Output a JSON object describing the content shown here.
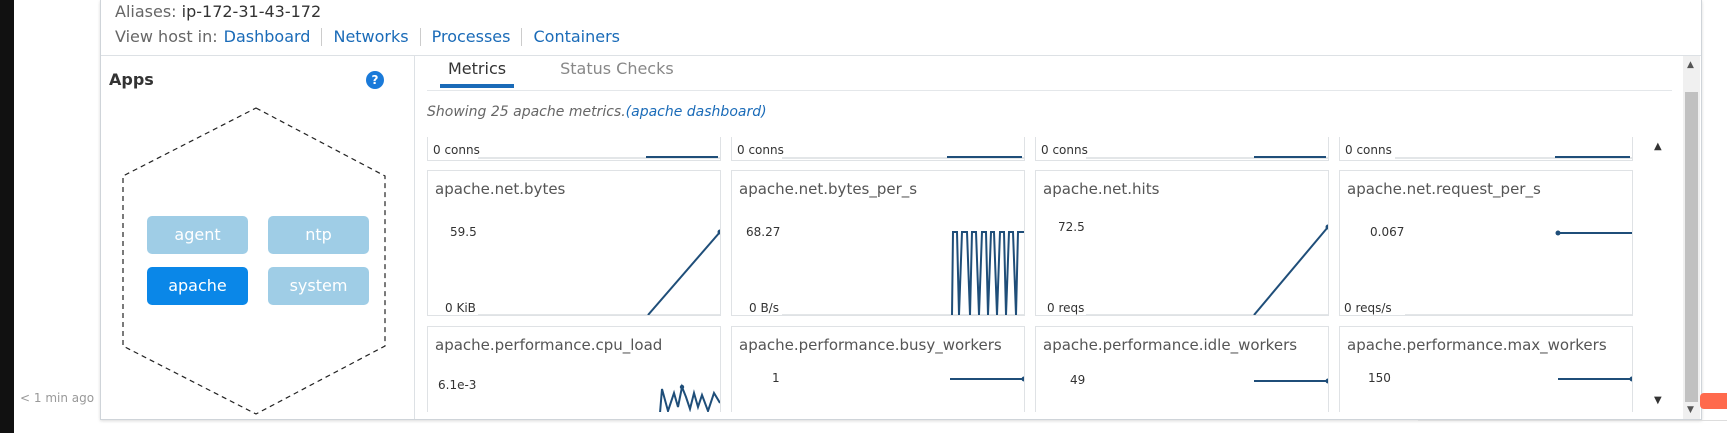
{
  "timestamp": "< 1 min ago",
  "host": {
    "aliases_label": "Aliases:",
    "aliases_value": "ip-172-31-43-172",
    "view_label": "View host in:",
    "links": [
      "Dashboard",
      "Networks",
      "Processes",
      "Containers"
    ]
  },
  "apps": {
    "title": "Apps",
    "help_icon": "question-circle-icon",
    "items": [
      {
        "label": "agent",
        "active": false
      },
      {
        "label": "ntp",
        "active": false
      },
      {
        "label": "apache",
        "active": true
      },
      {
        "label": "system",
        "active": false
      }
    ]
  },
  "tabs": [
    "Metrics",
    "Status Checks"
  ],
  "active_tab": "Metrics",
  "showing": {
    "text": "Showing 25 apache metrics.",
    "link": "(apache dashboard)"
  },
  "top_row": [
    "0 conns",
    "0 conns",
    "0 conns",
    "0 conns"
  ],
  "metrics": [
    {
      "name": "apache.net.bytes",
      "max": "59.5",
      "min": "0 KiB"
    },
    {
      "name": "apache.net.bytes_per_s",
      "max": "68.27",
      "min": "0 B/s"
    },
    {
      "name": "apache.net.hits",
      "max": "72.5",
      "min": "0 reqs"
    },
    {
      "name": "apache.net.request_per_s",
      "max": "0.067",
      "min": "0 reqs/s"
    },
    {
      "name": "apache.performance.cpu_load",
      "max": "6.1e-3",
      "min": ""
    },
    {
      "name": "apache.performance.busy_workers",
      "max": "1",
      "min": ""
    },
    {
      "name": "apache.performance.idle_workers",
      "max": "49",
      "min": ""
    },
    {
      "name": "apache.performance.max_workers",
      "max": "150",
      "min": ""
    }
  ],
  "colors": {
    "link": "#1a6bb8",
    "app_active": "#0a87e8",
    "app_inactive": "#9fcde6",
    "series": "#1f4e79"
  }
}
